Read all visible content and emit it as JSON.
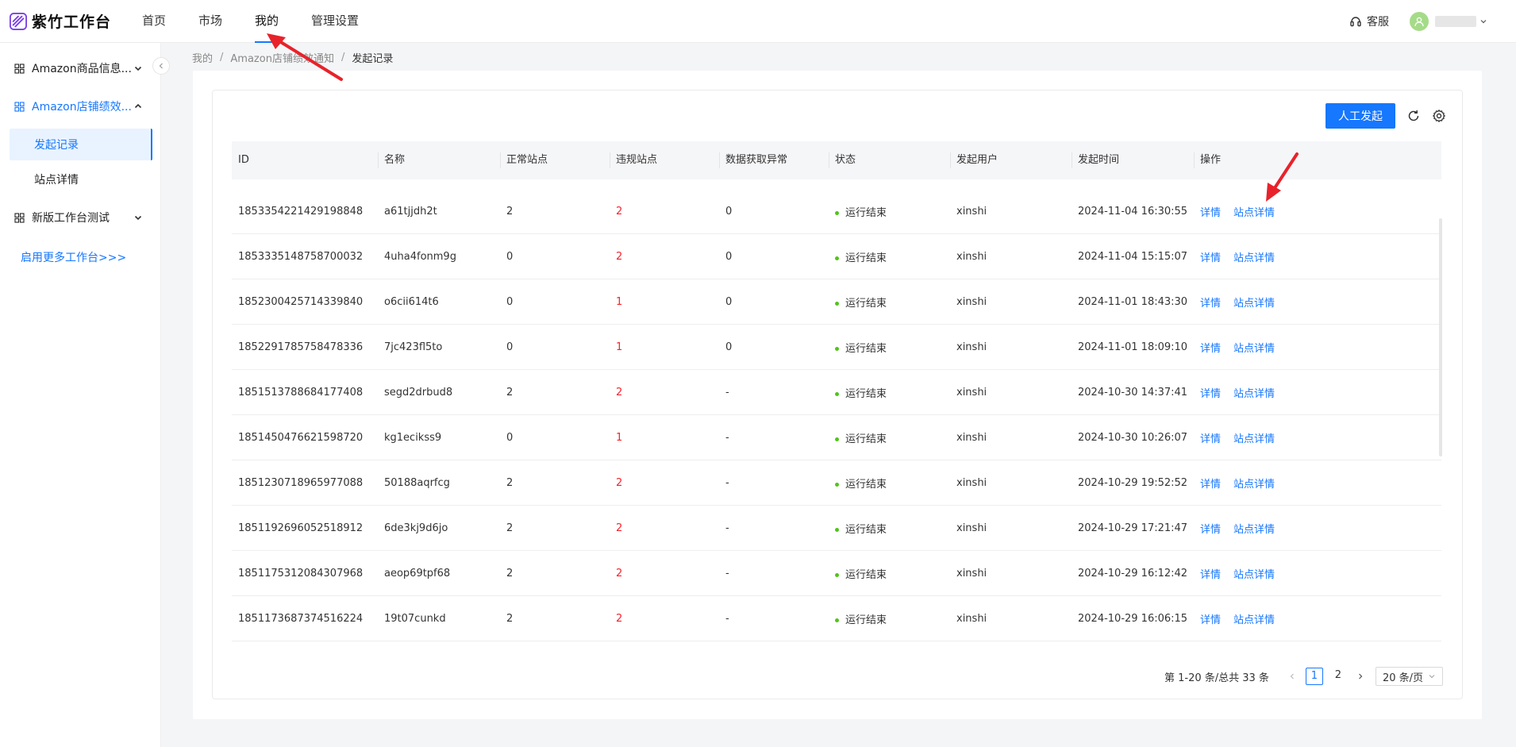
{
  "app": {
    "title": "紫竹工作台"
  },
  "nav": [
    {
      "label": "首页"
    },
    {
      "label": "市场"
    },
    {
      "label": "我的"
    },
    {
      "label": "管理设置"
    }
  ],
  "header": {
    "support_label": "客服"
  },
  "sidebar": {
    "groups": [
      {
        "label": "Amazon商品信息..."
      },
      {
        "label": "Amazon店铺绩效..."
      },
      {
        "label": "新版工作台测试"
      }
    ],
    "subitems": [
      {
        "label": "发起记录"
      },
      {
        "label": "站点详情"
      }
    ],
    "more_label": "启用更多工作台>>>"
  },
  "breadcrumb": [
    "我的",
    "Amazon店铺绩效通知",
    "发起记录"
  ],
  "toolbar": {
    "manual_button": "人工发起"
  },
  "table": {
    "columns": [
      "ID",
      "名称",
      "正常站点",
      "违规站点",
      "数据获取异常",
      "状态",
      "发起用户",
      "发起时间",
      "操作"
    ],
    "action_labels": {
      "detail": "详情",
      "site_detail": "站点详情"
    },
    "rows": [
      {
        "id": "1853354221429198848",
        "name": "a61tjjdh2t",
        "normal": "2",
        "violation": "2",
        "error": "0",
        "status": "运行结束",
        "user": "xinshi",
        "time": "2024-11-04 16:30:55"
      },
      {
        "id": "1853335148758700032",
        "name": "4uha4fonm9g",
        "normal": "0",
        "violation": "2",
        "error": "0",
        "status": "运行结束",
        "user": "xinshi",
        "time": "2024-11-04 15:15:07"
      },
      {
        "id": "1852300425714339840",
        "name": "o6cii614t6",
        "normal": "0",
        "violation": "1",
        "error": "0",
        "status": "运行结束",
        "user": "xinshi",
        "time": "2024-11-01 18:43:30"
      },
      {
        "id": "1852291785758478336",
        "name": "7jc423fl5to",
        "normal": "0",
        "violation": "1",
        "error": "0",
        "status": "运行结束",
        "user": "xinshi",
        "time": "2024-11-01 18:09:10"
      },
      {
        "id": "1851513788684177408",
        "name": "segd2drbud8",
        "normal": "2",
        "violation": "2",
        "error": "-",
        "status": "运行结束",
        "user": "xinshi",
        "time": "2024-10-30 14:37:41"
      },
      {
        "id": "1851450476621598720",
        "name": "kg1ecikss9",
        "normal": "0",
        "violation": "1",
        "error": "-",
        "status": "运行结束",
        "user": "xinshi",
        "time": "2024-10-30 10:26:07"
      },
      {
        "id": "1851230718965977088",
        "name": "50188aqrfcg",
        "normal": "2",
        "violation": "2",
        "error": "-",
        "status": "运行结束",
        "user": "xinshi",
        "time": "2024-10-29 19:52:52"
      },
      {
        "id": "1851192696052518912",
        "name": "6de3kj9d6jo",
        "normal": "2",
        "violation": "2",
        "error": "-",
        "status": "运行结束",
        "user": "xinshi",
        "time": "2024-10-29 17:21:47"
      },
      {
        "id": "1851175312084307968",
        "name": "aeop69tpf68",
        "normal": "2",
        "violation": "2",
        "error": "-",
        "status": "运行结束",
        "user": "xinshi",
        "time": "2024-10-29 16:12:42"
      },
      {
        "id": "1851173687374516224",
        "name": "19t07cunkd",
        "normal": "2",
        "violation": "2",
        "error": "-",
        "status": "运行结束",
        "user": "xinshi",
        "time": "2024-10-29 16:06:15"
      }
    ]
  },
  "pagination": {
    "total_text": "第 1-20 条/总共 33 条",
    "pages": [
      "1",
      "2"
    ],
    "page_size": "20 条/页"
  },
  "colors": {
    "accent": "#1677ff",
    "danger": "#f5222d",
    "success": "#52c41a",
    "annotation": "#e8222a"
  }
}
